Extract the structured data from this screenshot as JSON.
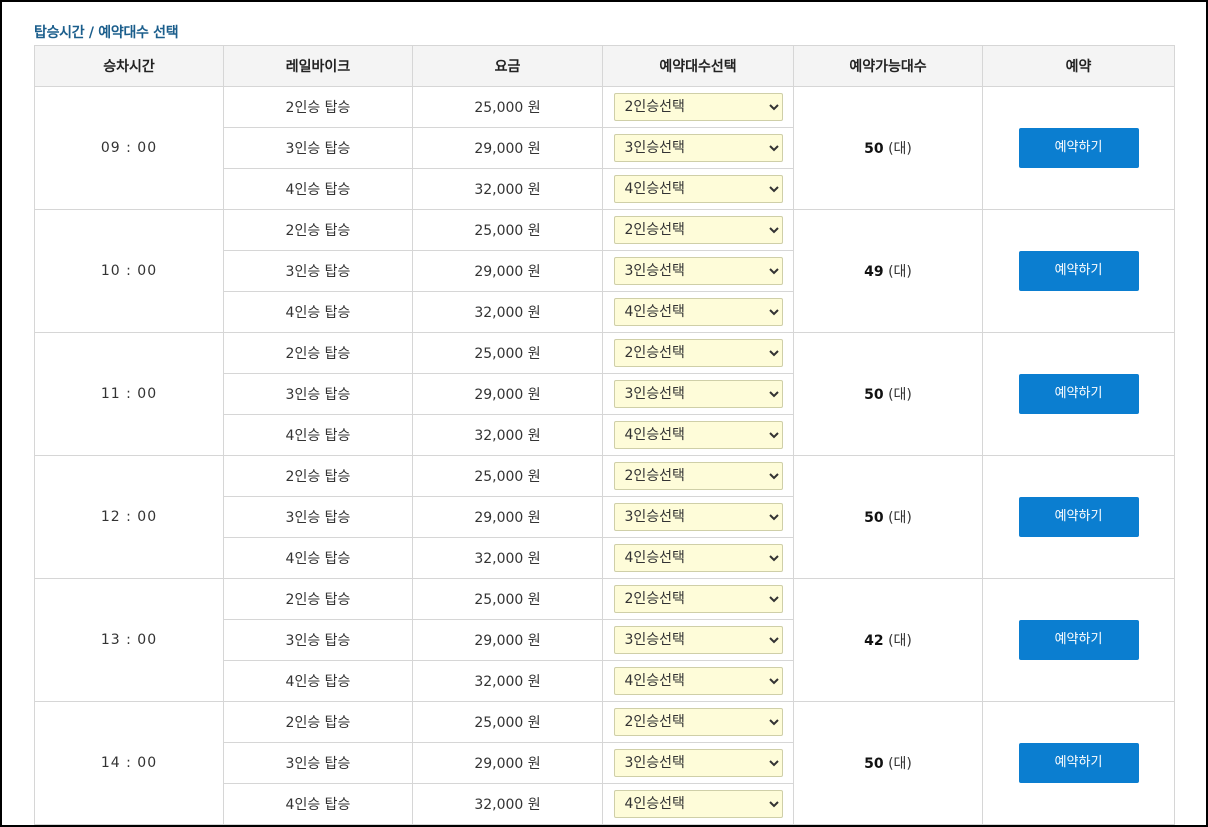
{
  "section_title": "탑승시간 / 예약대수 선택",
  "headers": [
    "승차시간",
    "레일바이크",
    "요금",
    "예약대수선택",
    "예약가능대수",
    "예약"
  ],
  "unit_suffix": "(대)",
  "button_label": "예약하기",
  "slots": [
    {
      "time": "09 : 00",
      "available": "50",
      "options": [
        {
          "bike": "2인승 탑승",
          "price": "25,000 원",
          "select": "2인승선택"
        },
        {
          "bike": "3인승 탑승",
          "price": "29,000 원",
          "select": "3인승선택"
        },
        {
          "bike": "4인승 탑승",
          "price": "32,000 원",
          "select": "4인승선택"
        }
      ]
    },
    {
      "time": "10 : 00",
      "available": "49",
      "options": [
        {
          "bike": "2인승 탑승",
          "price": "25,000 원",
          "select": "2인승선택"
        },
        {
          "bike": "3인승 탑승",
          "price": "29,000 원",
          "select": "3인승선택"
        },
        {
          "bike": "4인승 탑승",
          "price": "32,000 원",
          "select": "4인승선택"
        }
      ]
    },
    {
      "time": "11 : 00",
      "available": "50",
      "options": [
        {
          "bike": "2인승 탑승",
          "price": "25,000 원",
          "select": "2인승선택"
        },
        {
          "bike": "3인승 탑승",
          "price": "29,000 원",
          "select": "3인승선택"
        },
        {
          "bike": "4인승 탑승",
          "price": "32,000 원",
          "select": "4인승선택"
        }
      ]
    },
    {
      "time": "12 : 00",
      "available": "50",
      "options": [
        {
          "bike": "2인승 탑승",
          "price": "25,000 원",
          "select": "2인승선택"
        },
        {
          "bike": "3인승 탑승",
          "price": "29,000 원",
          "select": "3인승선택"
        },
        {
          "bike": "4인승 탑승",
          "price": "32,000 원",
          "select": "4인승선택"
        }
      ]
    },
    {
      "time": "13 : 00",
      "available": "42",
      "options": [
        {
          "bike": "2인승 탑승",
          "price": "25,000 원",
          "select": "2인승선택"
        },
        {
          "bike": "3인승 탑승",
          "price": "29,000 원",
          "select": "3인승선택"
        },
        {
          "bike": "4인승 탑승",
          "price": "32,000 원",
          "select": "4인승선택"
        }
      ]
    },
    {
      "time": "14 : 00",
      "available": "50",
      "options": [
        {
          "bike": "2인승 탑승",
          "price": "25,000 원",
          "select": "2인승선택"
        },
        {
          "bike": "3인승 탑승",
          "price": "29,000 원",
          "select": "3인승선택"
        },
        {
          "bike": "4인승 탑승",
          "price": "32,000 원",
          "select": "4인승선택"
        }
      ]
    }
  ]
}
